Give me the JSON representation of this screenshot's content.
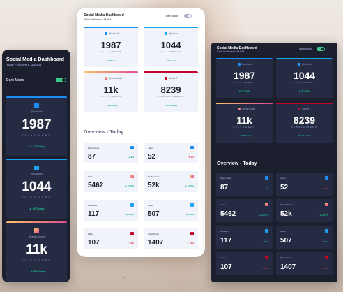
{
  "dashboard": {
    "title": "Social Media Dashboard",
    "total_followers": "Total Followers: 23,004",
    "dark_mode_label": "Dark Mode"
  },
  "colors": {
    "facebook": "#198ff5",
    "twitter": "#1ca0f2",
    "instagram_start": "#fdc468",
    "instagram_end": "#df4996",
    "youtube": "#c4032a",
    "up": "#1db489",
    "down": "#dc414c",
    "dark_bg": "#1c1f2e",
    "dark_card": "#252b42",
    "toggle_on": "#3ec88b"
  },
  "followers": [
    {
      "network": "facebook",
      "icon": "facebook-icon",
      "handle": "@nathanf",
      "count": "1987",
      "label": "FOLLOWERS",
      "change": "▲ 12 Today",
      "trend": "up"
    },
    {
      "network": "twitter",
      "icon": "twitter-icon",
      "handle": "@nathanf",
      "count": "1044",
      "label": "FOLLOWERS",
      "change": "▲ 99 Today",
      "trend": "up"
    },
    {
      "network": "instagram",
      "icon": "instagram-icon",
      "handle": "@realnathanf",
      "count": "11k",
      "label": "FOLLOWERS",
      "change": "▲ 1099 Today",
      "trend": "up"
    },
    {
      "network": "youtube",
      "icon": "youtube-icon",
      "handle": "Nathan F.",
      "count": "8239",
      "label": "SUBSCRIBERS",
      "change": "▼ 144 Today",
      "trend": "down"
    }
  ],
  "overview": {
    "title": "Overview - Today",
    "items": [
      {
        "label": "Page Views",
        "icon": "facebook-icon",
        "value": "87",
        "change": "▲ 3%",
        "trend": "up"
      },
      {
        "label": "Likes",
        "icon": "facebook-icon",
        "value": "52",
        "change": "▼ 2%",
        "trend": "down"
      },
      {
        "label": "Likes",
        "icon": "instagram-icon",
        "value": "5462",
        "change": "▲ 2257%",
        "trend": "up"
      },
      {
        "label": "Profile Views",
        "icon": "instagram-icon",
        "value": "52k",
        "change": "▲ 1375%",
        "trend": "up"
      },
      {
        "label": "Retweets",
        "icon": "twitter-icon",
        "value": "117",
        "change": "▲ 303%",
        "trend": "up"
      },
      {
        "label": "Likes",
        "icon": "twitter-icon",
        "value": "507",
        "change": "▲ 553%",
        "trend": "up"
      },
      {
        "label": "Likes",
        "icon": "youtube-icon",
        "value": "107",
        "change": "▼ 19%",
        "trend": "down"
      },
      {
        "label": "Total Views",
        "icon": "youtube-icon",
        "value": "1407",
        "change": "▼ 12%",
        "trend": "down"
      }
    ]
  }
}
